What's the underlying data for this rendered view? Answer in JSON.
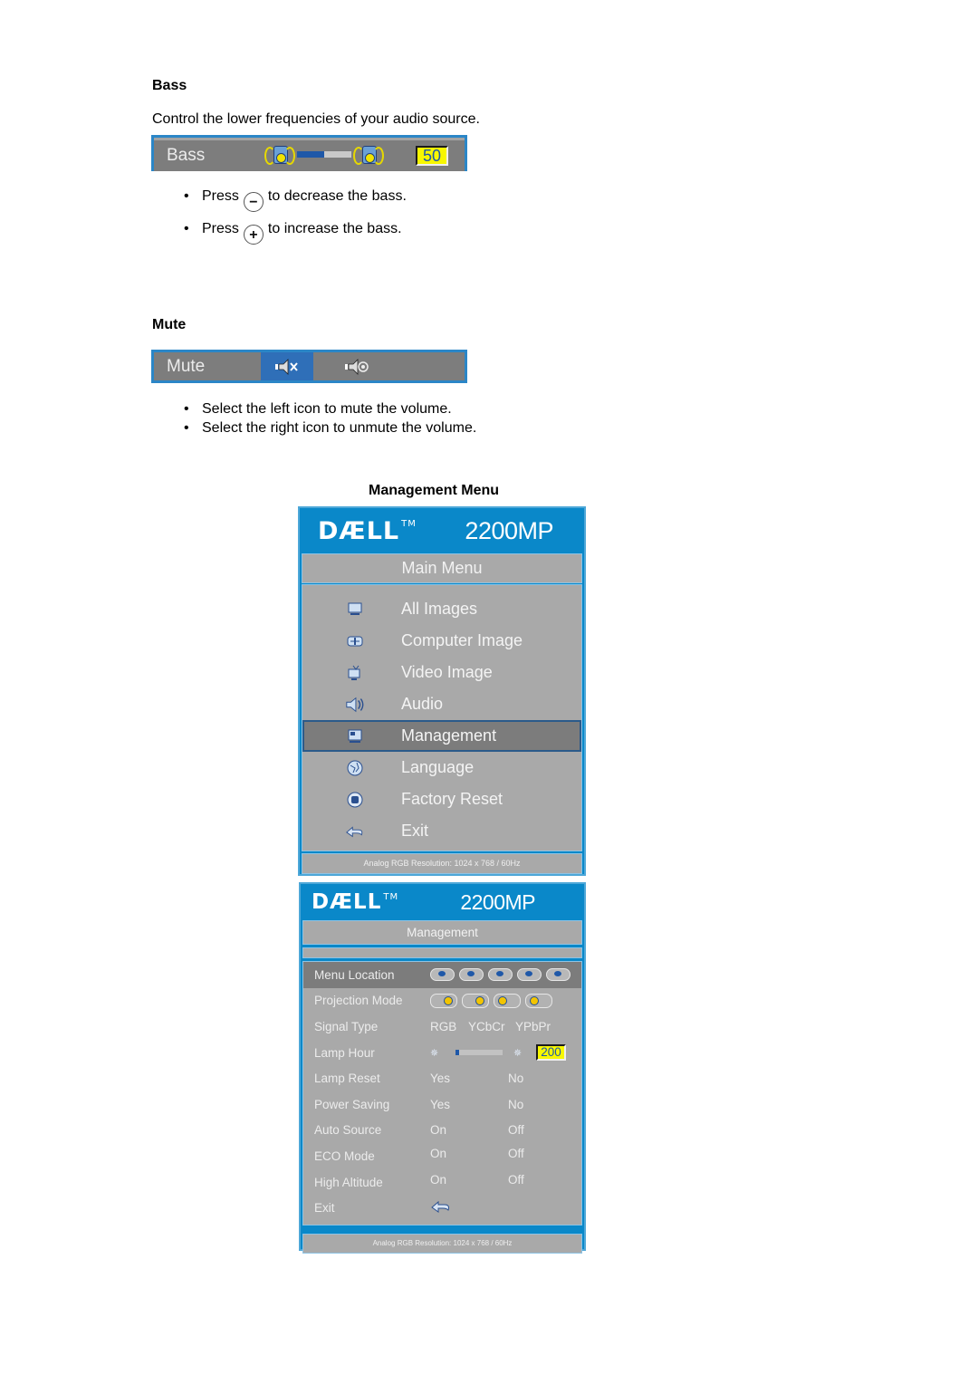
{
  "bass_section": {
    "heading": "Bass",
    "description": "Control the lower frequencies of your audio source.",
    "osd": {
      "label": "Bass",
      "level_percent": 50,
      "value": "50",
      "left_icon": "speaker-low-icon",
      "right_icon": "speaker-high-icon"
    },
    "bullets": [
      {
        "prefix": "Press",
        "button_icon": "minus-button-icon",
        "button_glyph": "−",
        "suffix": "to decrease the bass."
      },
      {
        "prefix": "Press",
        "button_icon": "plus-button-icon",
        "button_glyph": "+",
        "suffix": "to increase the bass."
      }
    ]
  },
  "mute_section": {
    "heading": "Mute",
    "osd": {
      "label": "Mute",
      "options": [
        {
          "icon": "speaker-muted-icon",
          "selected": true
        },
        {
          "icon": "speaker-sound-icon",
          "selected": false
        }
      ]
    },
    "bullets": [
      "Select the left icon to mute the volume.",
      "Select the right icon to unmute the volume."
    ]
  },
  "management_section": {
    "heading": "Management Menu",
    "colors": {
      "osd_blue": "#0a88c9",
      "panel_grey": "#a9a9a9",
      "selected_grey": "#7c7c7c",
      "value_yellow": "#f7f700"
    },
    "main_menu": {
      "brand": "DÆLL",
      "trademark": "TM",
      "model": "2200MP",
      "title": "Main Menu",
      "items": [
        {
          "label": "All Images",
          "icon": "all-images-icon",
          "selected": false
        },
        {
          "label": "Computer Image",
          "icon": "computer-image-icon",
          "selected": false
        },
        {
          "label": "Video Image",
          "icon": "video-image-icon",
          "selected": false
        },
        {
          "label": "Audio",
          "icon": "audio-icon",
          "selected": false
        },
        {
          "label": "Management",
          "icon": "management-icon",
          "selected": true
        },
        {
          "label": "Language",
          "icon": "language-icon",
          "selected": false
        },
        {
          "label": "Factory Reset",
          "icon": "factory-reset-icon",
          "selected": false
        },
        {
          "label": "Exit",
          "icon": "exit-arrow-icon",
          "selected": false
        }
      ],
      "status": "Analog RGB Resolution: 1024 x 768 / 60Hz"
    },
    "management_menu": {
      "brand": "DÆLL",
      "trademark": "TM",
      "model": "2200MP",
      "title": "Management",
      "rows": {
        "menu_location": {
          "label": "Menu Location",
          "option_count": 5
        },
        "projection_mode": {
          "label": "Projection Mode",
          "option_count": 4
        },
        "signal_type": {
          "label": "Signal Type",
          "options": [
            "RGB",
            "YCbCr",
            "YPbPr"
          ]
        },
        "lamp_hour": {
          "label": "Lamp Hour",
          "value": "200",
          "level_percent": 8
        },
        "lamp_reset": {
          "label": "Lamp Reset",
          "options": [
            "Yes",
            "No"
          ]
        },
        "power_saving": {
          "label": "Power Saving",
          "options": [
            "Yes",
            "No"
          ]
        },
        "auto_source": {
          "label": "Auto Source",
          "options": [
            "On",
            "Off"
          ]
        },
        "eco_mode": {
          "label": "ECO Mode",
          "options": [
            "On",
            "Off"
          ]
        },
        "high_altitude": {
          "label": "High Altitude",
          "options": [
            "On",
            "Off"
          ]
        },
        "exit": {
          "label": "Exit",
          "icon": "exit-arrow-icon"
        }
      },
      "status": "Analog RGB Resolution: 1024 x 768 / 60Hz"
    }
  }
}
